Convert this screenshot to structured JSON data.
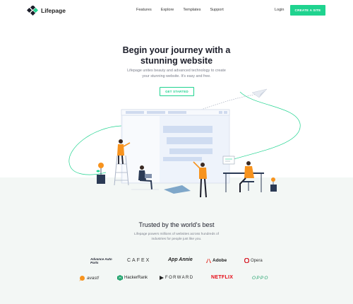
{
  "header": {
    "logo_text": "Lifepage",
    "nav": [
      "Features",
      "Explore",
      "Templates",
      "Support"
    ],
    "login": "Login",
    "cta": "CREATE A SITE"
  },
  "hero": {
    "title_line1": "Begin your journey with a",
    "title_line2": "stunning website",
    "subtitle_line1": "Lifepage unites beauty and advanced technology to create",
    "subtitle_line2": "your stunning website. It's easy and free.",
    "button": "GET STARTED"
  },
  "trusted": {
    "title": "Trusted by the world's best",
    "subtitle_line1": "Lifepage powers millions of websites across hundreds of",
    "subtitle_line2": "industries for people just like you."
  },
  "brands": {
    "row1": [
      "Advance Auto Parts",
      "CAFEX",
      "App Annie",
      "Adobe",
      "Opera"
    ],
    "row2": [
      "avast!",
      "HackerRank",
      "FORWARD",
      "NETFLIX",
      "OPPO"
    ]
  },
  "colors": {
    "accent": "#1fd38f",
    "orange": "#f7931e",
    "netflix": "#e50914",
    "adobe": "#e1251b",
    "opera": "#d61a25",
    "oppo": "#1aa068"
  }
}
